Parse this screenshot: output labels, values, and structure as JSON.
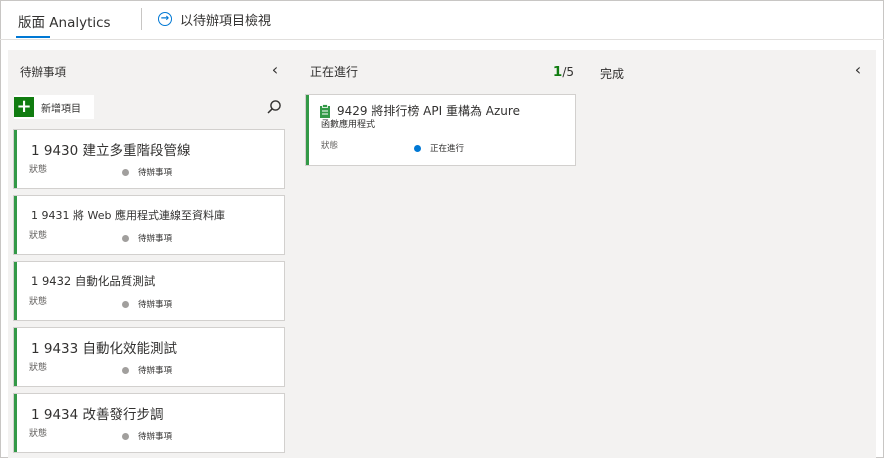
{
  "tabs": {
    "active_label": "版面 Analytics",
    "backlog_view_label": "以待辦項目檢視"
  },
  "columns": {
    "backlog": {
      "title": "待辦事項",
      "add_label": "新增項目"
    },
    "doing": {
      "title": "正在進行",
      "wip_count": "1",
      "wip_limit": "/5"
    },
    "done": {
      "title": "完成"
    }
  },
  "backlog_cards": [
    {
      "title": "1 9430 建立多重階段管線",
      "field_label": "狀態",
      "field_value": "待辦事項"
    },
    {
      "title": "1 9431 將 Web 應用程式連線至資料庫",
      "field_label": "狀態",
      "field_value": "待辦事項"
    },
    {
      "title": "1 9432 自動化品質測試",
      "field_label": "狀態",
      "field_value": "待辦事項"
    },
    {
      "title": "1 9433 自動化效能測試",
      "field_label": "狀態",
      "field_value": "待辦事項"
    },
    {
      "title": "1 9434 改善發行步調",
      "field_label": "狀態",
      "field_value": "待辦事項"
    }
  ],
  "doing_card": {
    "title_line1": "9429 將排行榜 API 重構為 Azure",
    "title_line2": "函數應用程式",
    "field_label": "狀態",
    "field_value": "正在進行"
  },
  "colors": {
    "accent": "#0078d4",
    "card_border": "#339947",
    "add_button": "#107c10",
    "todo_dot": "#a19f9d",
    "doing_dot": "#0078d4"
  },
  "icons": {
    "collapse": "chevron-left-icon",
    "search": "search-icon",
    "add": "plus-icon",
    "backlog_view": "arrow-right-circle-icon",
    "work_item": "clipboard-icon"
  }
}
